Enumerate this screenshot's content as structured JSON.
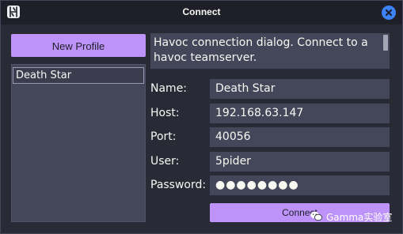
{
  "window": {
    "title": "Connect"
  },
  "icons": {
    "app_icon": "havoc-logo-icon",
    "close_icon": "close-icon",
    "watermark_icon": "wechat-icon"
  },
  "sidebar": {
    "new_profile_label": "New Profile",
    "profiles": [
      {
        "name": "Death Star"
      }
    ]
  },
  "info": {
    "text": "Havoc connection dialog. Connect to a havoc teamserver."
  },
  "form": {
    "name": {
      "label": "Name:",
      "value": "Death Star"
    },
    "host": {
      "label": "Host:",
      "value": "192.168.63.147"
    },
    "port": {
      "label": "Port:",
      "value": "40056"
    },
    "user": {
      "label": "User:",
      "value": "5pider"
    },
    "password": {
      "label": "Password:",
      "value": "●●●●●●●●"
    }
  },
  "actions": {
    "connect_label": "Connect"
  },
  "watermark": {
    "text": "Gamma实验室"
  },
  "colors": {
    "background": "#282a36",
    "titlebar": "#1e1f29",
    "field": "#44475a",
    "accent": "#bd93f9",
    "close_button": "#3b82f6",
    "text": "#f8f8f2"
  }
}
